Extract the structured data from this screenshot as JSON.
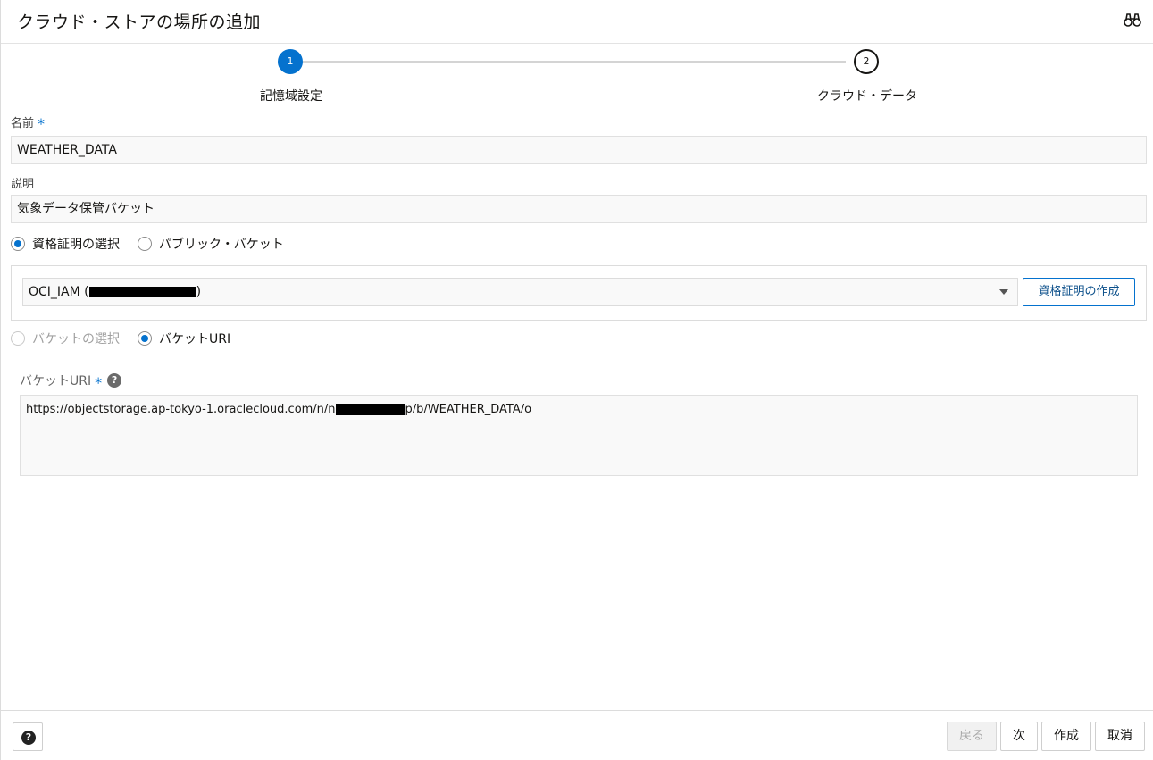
{
  "dialog": {
    "title": "クラウド・ストアの場所の追加"
  },
  "train": {
    "steps": [
      {
        "number": "1",
        "label": "記憶域設定"
      },
      {
        "number": "2",
        "label": "クラウド・データ"
      }
    ]
  },
  "form": {
    "name_label": "名前",
    "name_value": "WEATHER_DATA",
    "description_label": "説明",
    "description_value": "気象データ保管バケット",
    "required_mark": "*",
    "credential_mode": {
      "option1": "資格証明の選択",
      "option2": "パブリック・バケット"
    },
    "credential_select_value": "OCI_IAM (",
    "credential_select_suffix": ")",
    "create_credential_label": "資格証明の作成",
    "bucket_mode": {
      "option1": "バケットの選択",
      "option2": "バケットURI"
    },
    "bucket_uri_label": "バケットURI",
    "bucket_uri_part1": "https://objectstorage.ap-tokyo-1.oraclecloud.com/n/n",
    "bucket_uri_part2": "p/b/WEATHER_DATA/o"
  },
  "footer": {
    "back_label": "戻る",
    "next_label": "次",
    "create_label": "作成",
    "cancel_label": "取消"
  },
  "colors": {
    "accent": "#0572ce"
  },
  "icons": {
    "header": "binoculars-icon",
    "help": "help-icon"
  }
}
